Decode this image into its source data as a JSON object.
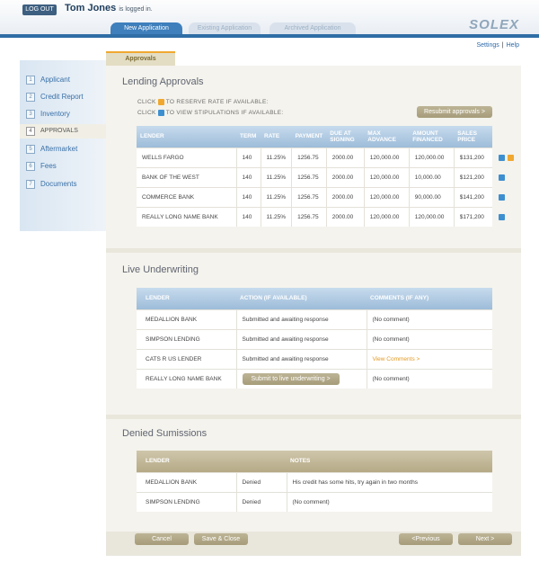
{
  "header": {
    "logout": "LOG OUT",
    "user_name": "Tom Jones",
    "logged_in_text": "is logged in.",
    "logo": "SOLEX"
  },
  "tabs": [
    {
      "label": "New Application"
    },
    {
      "label": "Existing Application"
    },
    {
      "label": "Archived Application"
    }
  ],
  "links": {
    "settings": "Settings",
    "separator": "|",
    "help": "Help"
  },
  "sidebar": {
    "items": [
      {
        "num": "1",
        "label": "Applicant"
      },
      {
        "num": "2",
        "label": "Credit Report"
      },
      {
        "num": "3",
        "label": "Inventory"
      },
      {
        "num": "4",
        "label": "APPROVALS"
      },
      {
        "num": "5",
        "label": "Aftermarket"
      },
      {
        "num": "6",
        "label": "Fees"
      },
      {
        "num": "7",
        "label": "Documents"
      }
    ]
  },
  "app_tab": "Approvals",
  "lending": {
    "title": "Lending Approvals",
    "hint1_pre": "CLICK",
    "hint1_post": "TO RESERVE RATE IF AVAILABLE:",
    "hint2_pre": "CLICK",
    "hint2_post": "TO VIEW  STIPULATIONS IF AVAILABLE:",
    "resubmit": "Resubmit approvals >",
    "headers": [
      "LENDER",
      "TERM",
      "RATE",
      "PAYMENT",
      "DUE AT SIGNING",
      "MAX ADVANCE",
      "AMOUNT FINANCED",
      "SALES PRICE"
    ],
    "rows": [
      [
        "WELLS FARGO",
        "140",
        "11.25%",
        "1256.75",
        "2000.00",
        "120,000.00",
        "120,000.00",
        "$131,200"
      ],
      [
        "BANK OF THE WEST",
        "140",
        "11.25%",
        "1256.75",
        "2000.00",
        "120,000.00",
        "10,000.00",
        "$121,200"
      ],
      [
        "COMMERCE BANK",
        "140",
        "11.25%",
        "1256.75",
        "2000.00",
        "120,000.00",
        "90,000.00",
        "$141,200"
      ],
      [
        "REALLY LONG NAME BANK",
        "140",
        "11.25%",
        "1256.75",
        "2000.00",
        "120,000.00",
        "120,000.00",
        "$171,200"
      ]
    ],
    "icon_colors": {
      "reserve": "#f0a830",
      "stipulation": "#3e8fd0"
    }
  },
  "live": {
    "title": "Live Underwriting",
    "headers": [
      "LENDER",
      "ACTION (IF AVAILABLE)",
      "COMMENTS (IF ANY)"
    ],
    "rows": [
      [
        "MEDALLION BANK",
        "Submitted and awaiting response",
        "(No comment)"
      ],
      [
        "SIMPSON LENDING",
        "Submitted and awaiting response",
        "(No comment)"
      ],
      [
        "CATS R US LENDER",
        "Submitted and awaiting response",
        "View Comments >"
      ],
      [
        "REALLY LONG NAME BANK",
        "Submit to live underwriting >",
        "(No comment)"
      ]
    ]
  },
  "denied": {
    "title": "Denied Sumissions",
    "headers": [
      "LENDER",
      "",
      "NOTES"
    ],
    "rows": [
      [
        "MEDALLION BANK",
        "Denied",
        "His credit has some hits, try again in two months"
      ],
      [
        "SIMPSON LENDING",
        "Denied",
        "(No comment)"
      ]
    ]
  },
  "footer": {
    "cancel": "Cancel",
    "save_close": "Save & Close",
    "previous": "<Previous",
    "next": "Next >"
  }
}
